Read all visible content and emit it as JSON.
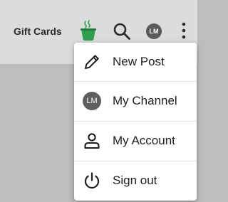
{
  "topbar": {
    "gift_cards_label": "Gift Cards",
    "icons": [
      "coffee-cup-icon",
      "search-icon",
      "avatar",
      "more-vert-icon"
    ],
    "avatar_initials": "LM",
    "brand_color": "#2e9e4f"
  },
  "menu": {
    "items": [
      {
        "label": "New Post",
        "icon": "pencil-icon"
      },
      {
        "label": "My Channel",
        "icon": "avatar",
        "initials": "LM"
      },
      {
        "label": "My Account",
        "icon": "person-icon"
      },
      {
        "label": "Sign out",
        "icon": "power-icon"
      }
    ]
  }
}
